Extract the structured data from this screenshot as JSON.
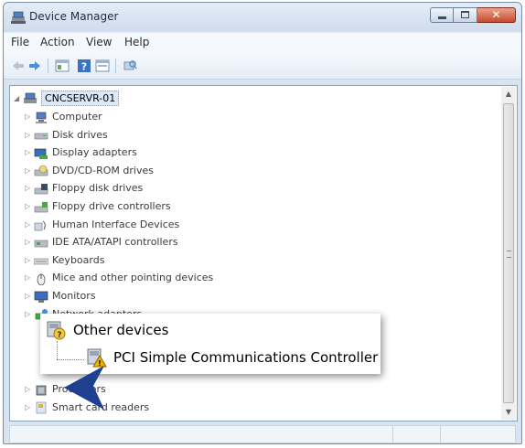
{
  "window": {
    "title": "Device Manager"
  },
  "menu": [
    "File",
    "Action",
    "View",
    "Help"
  ],
  "toolbar": [
    "back-icon",
    "forward-icon",
    "properties-icon",
    "help-icon",
    "list-view-icon",
    "scan-hardware-icon"
  ],
  "tree": {
    "root": "CNCSERVR-01",
    "categories": [
      {
        "label": "Computer",
        "icon": "computer-icon"
      },
      {
        "label": "Disk drives",
        "icon": "disk-drive-icon"
      },
      {
        "label": "Display adapters",
        "icon": "display-adapter-icon"
      },
      {
        "label": "DVD/CD-ROM drives",
        "icon": "dvd-drive-icon"
      },
      {
        "label": "Floppy disk drives",
        "icon": "floppy-disk-icon"
      },
      {
        "label": "Floppy drive controllers",
        "icon": "floppy-controller-icon"
      },
      {
        "label": "Human Interface Devices",
        "icon": "hid-icon"
      },
      {
        "label": "IDE ATA/ATAPI controllers",
        "icon": "ide-controller-icon"
      },
      {
        "label": "Keyboards",
        "icon": "keyboard-icon"
      },
      {
        "label": "Mice and other pointing devices",
        "icon": "mouse-icon"
      },
      {
        "label": "Monitors",
        "icon": "monitor-icon"
      },
      {
        "label": "Network adapters",
        "icon": "network-adapter-icon"
      }
    ],
    "after_callout": [
      {
        "label": "Processors",
        "icon": "processor-icon"
      },
      {
        "label": "Smart card readers",
        "icon": "smart-card-icon"
      }
    ]
  },
  "callout": {
    "category": "Other devices",
    "device": "PCI Simple Communications Controller"
  },
  "colors": {
    "accent": "#1f3f8f",
    "warning": "#f0b400"
  }
}
